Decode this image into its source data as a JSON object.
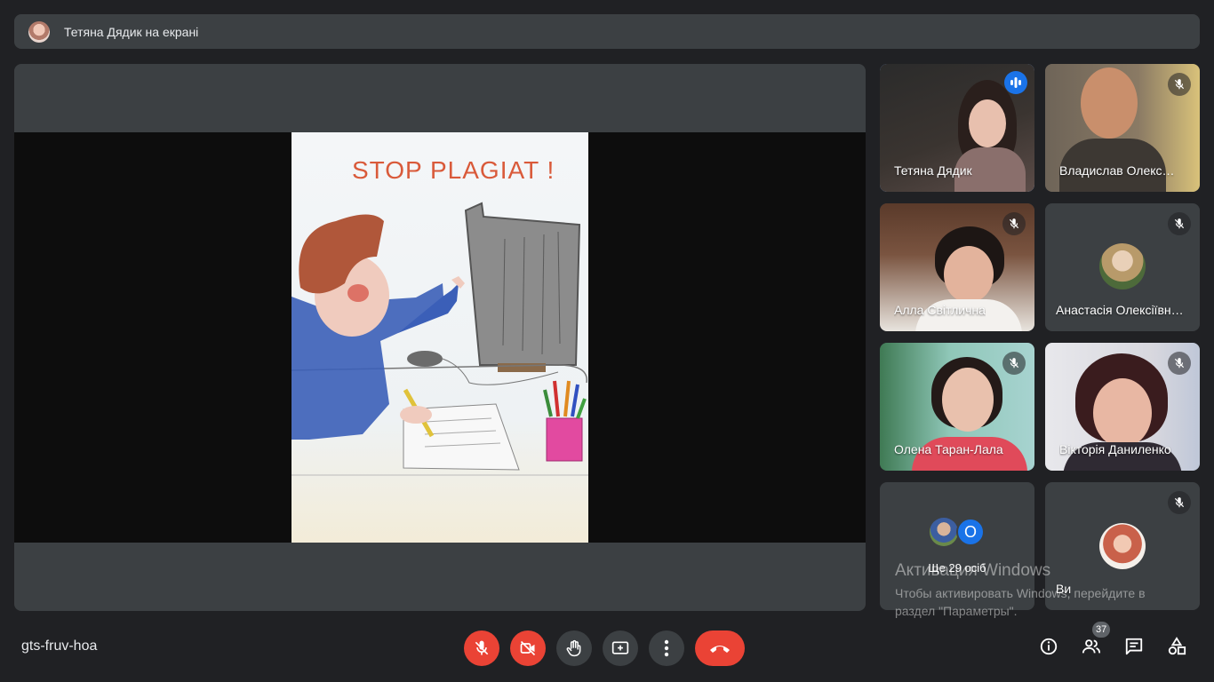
{
  "presentation_banner": {
    "text": "Тетяна Дядик на екрані"
  },
  "shared_screen": {
    "drawing_title": "STOP PLAGIAT !"
  },
  "participants": [
    {
      "name": "Тетяна Дядик",
      "speaking": true
    },
    {
      "name": "Владислав Олекс…",
      "muted": true
    },
    {
      "name": "Алла Світлична",
      "muted": true
    },
    {
      "name": "Анастасія Олексіївн…",
      "muted": true
    },
    {
      "name": "Олена Таран-Лала",
      "muted": true
    },
    {
      "name": "Вікторія Даниленко",
      "muted": true
    },
    {
      "name": "Ще 29 осіб",
      "initial": "О"
    },
    {
      "name": "Ви",
      "muted": true
    }
  ],
  "watermark": {
    "title": "Активация Windows",
    "line1": "Чтобы активировать Windows, перейдите в",
    "line2": "раздел \"Параметры\"."
  },
  "meeting_code": "gts-fruv-hoa",
  "controls": {
    "mic": "mic-off-icon",
    "camera": "camera-off-icon",
    "raise_hand": "hand-icon",
    "present": "present-icon",
    "more": "more-vert-icon",
    "leave": "call-end-icon"
  },
  "right_controls": {
    "people_count": "37"
  },
  "colors": {
    "background": "#202124",
    "tile": "#3c4043",
    "danger": "#ea4335",
    "speaking": "#1a73e8",
    "active_outline": "#8ab4f8"
  }
}
